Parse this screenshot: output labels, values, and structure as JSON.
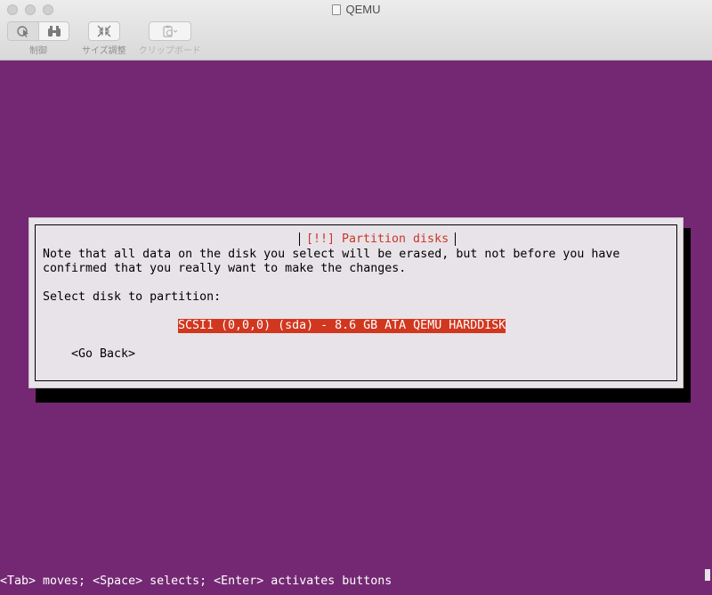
{
  "window": {
    "title": "QEMU"
  },
  "toolbar": {
    "control_label": "制御",
    "resize_label": "サイズ調整",
    "clipboard_label": "クリップボード"
  },
  "dialog": {
    "title": "[!!] Partition disks",
    "desc_line1": "Note that all data on the disk you select will be erased, but not before you have",
    "desc_line2": "confirmed that you really want to make the changes.",
    "prompt": "Select disk to partition:",
    "disk_option": "SCSI1 (0,0,0) (sda) - 8.6 GB ATA QEMU HARDDISK",
    "back_button": "<Go Back>"
  },
  "status_bar": "<Tab> moves; <Space> selects; <Enter> activates buttons",
  "colors": {
    "background": "#742873",
    "dialog": "#e8e3e8",
    "title": "#c8362a",
    "selection": "#d1371f"
  }
}
